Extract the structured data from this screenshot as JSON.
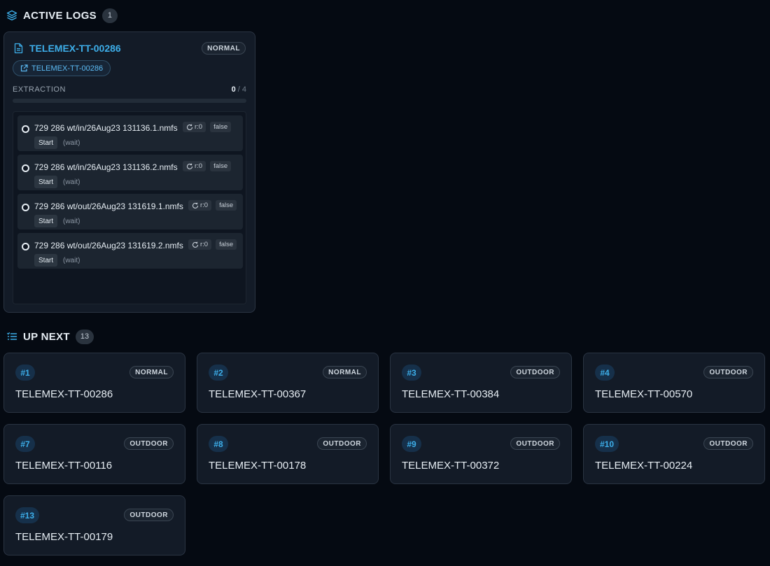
{
  "active": {
    "heading": "ACTIVE LOGS",
    "count": "1",
    "log": {
      "title": "TELEMEX-TT-00286",
      "category": "NORMAL",
      "link_label": "TELEMEX-TT-00286",
      "extraction_label": "EXTRACTION",
      "done": "0",
      "total": "/ 4",
      "progress": 0,
      "files": [
        {
          "name": "729 286 wt/in/26Aug23 131136.1.nmfs",
          "retries": "r:0",
          "flag": "false",
          "action": "Start",
          "state": "(wait)"
        },
        {
          "name": "729 286 wt/in/26Aug23 131136.2.nmfs",
          "retries": "r:0",
          "flag": "false",
          "action": "Start",
          "state": "(wait)"
        },
        {
          "name": "729 286 wt/out/26Aug23 131619.1.nmfs",
          "retries": "r:0",
          "flag": "false",
          "action": "Start",
          "state": "(wait)"
        },
        {
          "name": "729 286 wt/out/26Aug23 131619.2.nmfs",
          "retries": "r:0",
          "flag": "false",
          "action": "Start",
          "state": "(wait)"
        }
      ]
    }
  },
  "queue": {
    "heading": "UP NEXT",
    "count": "13",
    "items": [
      {
        "num": "#1",
        "tag": "NORMAL",
        "name": "TELEMEX-TT-00286"
      },
      {
        "num": "#2",
        "tag": "NORMAL",
        "name": "TELEMEX-TT-00367"
      },
      {
        "num": "#3",
        "tag": "OUTDOOR",
        "name": "TELEMEX-TT-00384"
      },
      {
        "num": "#4",
        "tag": "OUTDOOR",
        "name": "TELEMEX-TT-00570"
      },
      {
        "num": "#7",
        "tag": "OUTDOOR",
        "name": "TELEMEX-TT-00116"
      },
      {
        "num": "#8",
        "tag": "OUTDOOR",
        "name": "TELEMEX-TT-00178"
      },
      {
        "num": "#9",
        "tag": "OUTDOOR",
        "name": "TELEMEX-TT-00372"
      },
      {
        "num": "#10",
        "tag": "OUTDOOR",
        "name": "TELEMEX-TT-00224"
      },
      {
        "num": "#13",
        "tag": "OUTDOOR",
        "name": "TELEMEX-TT-00179"
      }
    ]
  },
  "icons": {
    "active_heading": "layers-icon",
    "log_title": "document-icon",
    "link": "external-link-icon",
    "retry": "refresh-icon",
    "queue_heading": "list-icon"
  },
  "colors": {
    "accent": "#3daee9",
    "background": "#050a12",
    "card": "#131b27"
  }
}
